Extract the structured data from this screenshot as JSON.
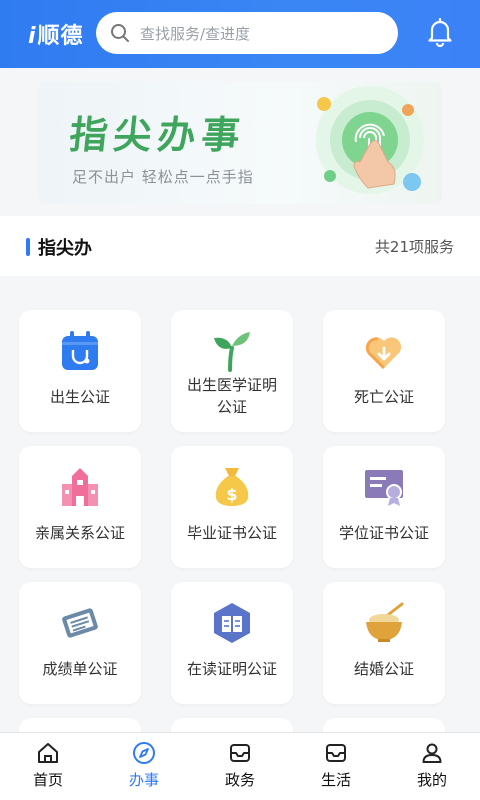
{
  "header": {
    "logo_prefix": "i",
    "logo_text": "顺德",
    "search_placeholder": "查找服务/查进度",
    "search_icon": "search-icon",
    "bell_icon": "bell-icon"
  },
  "banner": {
    "title": "指尖办事",
    "subtitle": "足不出户 轻松点一点手指"
  },
  "section": {
    "title": "指尖办",
    "count": "共21项服务"
  },
  "services": [
    {
      "label": "出生公证",
      "icon": "calendar-stethoscope-icon",
      "color": "#2f7bf0"
    },
    {
      "label": "出生医学证明公证",
      "icon": "sprout-icon",
      "color": "#3fa55d"
    },
    {
      "label": "死亡公证",
      "icon": "heart-down-icon",
      "color": "#f5a64a"
    },
    {
      "label": "亲属关系公证",
      "icon": "building-icon",
      "color": "#f06e9a"
    },
    {
      "label": "毕业证书公证",
      "icon": "money-bag-icon",
      "color": "#f5b93a"
    },
    {
      "label": "学位证书公证",
      "icon": "certificate-icon",
      "color": "#8a7bb8"
    },
    {
      "label": "成绩单公证",
      "icon": "ticket-icon",
      "color": "#6a8aa8"
    },
    {
      "label": "在读证明公证",
      "icon": "book-hexagon-icon",
      "color": "#5a74c9"
    },
    {
      "label": "结婚公证",
      "icon": "bowl-icon",
      "color": "#e0a23a"
    }
  ],
  "tabs": [
    {
      "label": "首页",
      "icon": "home-icon"
    },
    {
      "label": "办事",
      "icon": "compass-icon"
    },
    {
      "label": "政务",
      "icon": "inbox-icon"
    },
    {
      "label": "生活",
      "icon": "inbox-icon"
    },
    {
      "label": "我的",
      "icon": "user-icon"
    }
  ],
  "colors": {
    "accent": "#2f7bf0",
    "banner_green": "#3fa55d"
  }
}
